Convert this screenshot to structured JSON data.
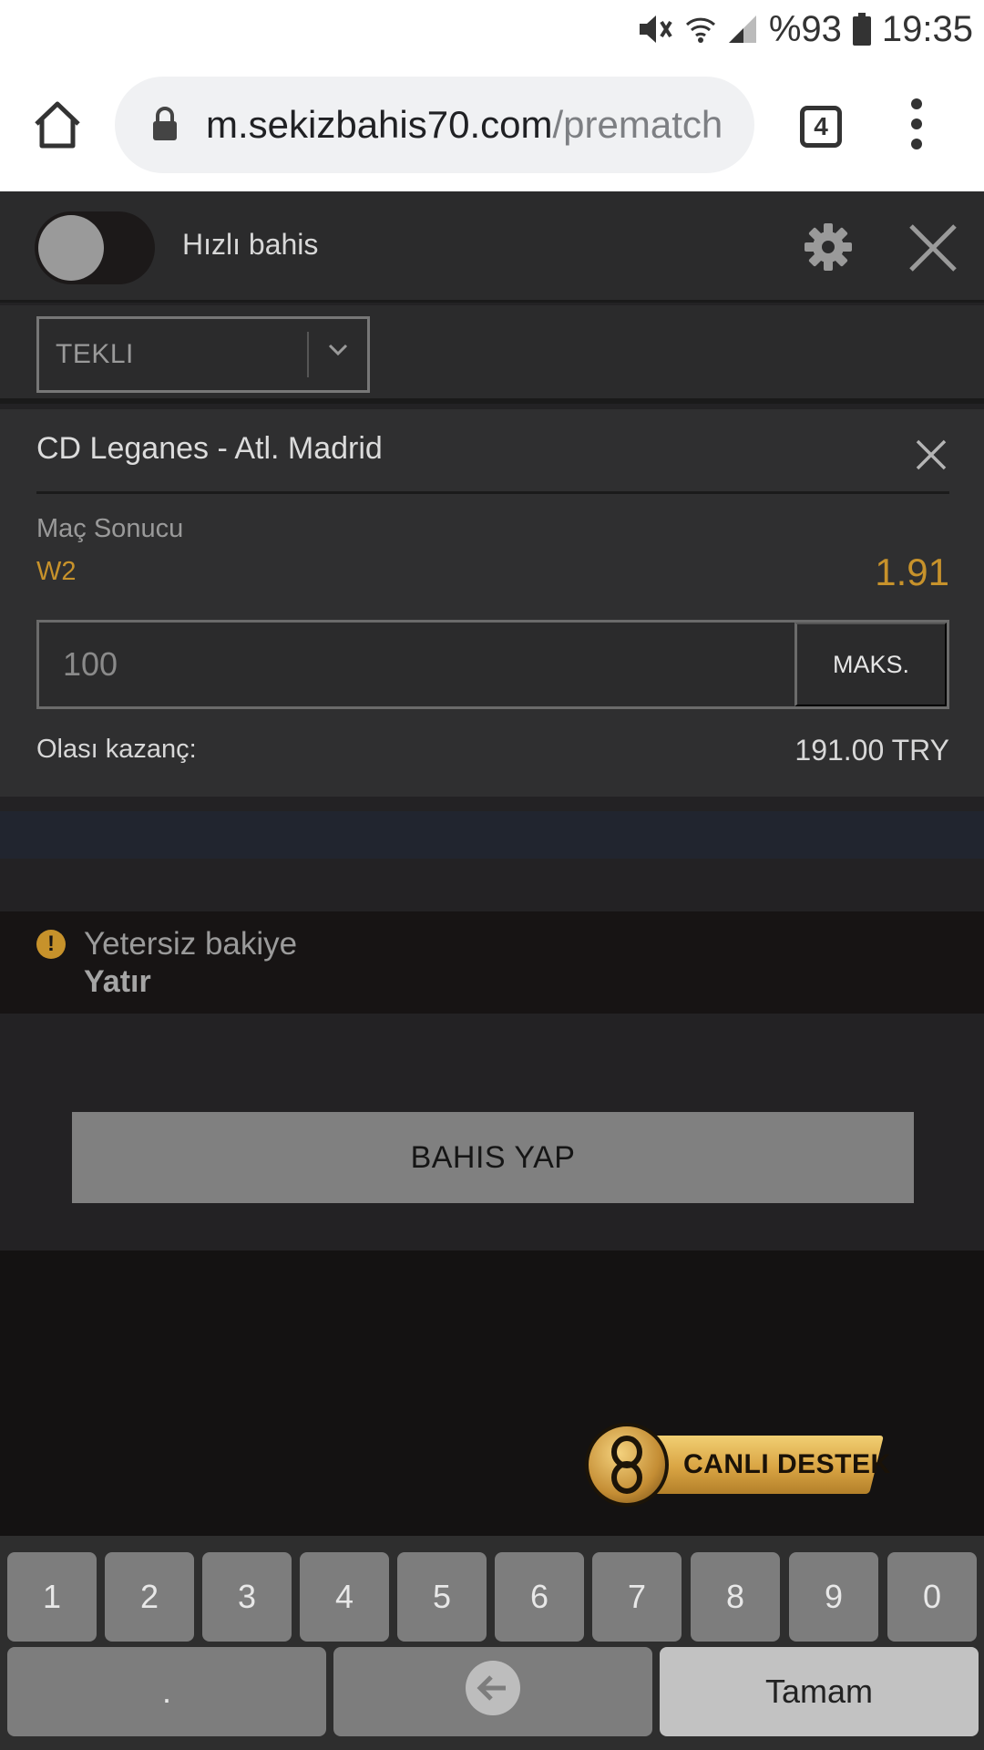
{
  "status_bar": {
    "battery_percent": "%93",
    "time": "19:35"
  },
  "browser": {
    "url_host": "m.sekizbahis70.com",
    "url_path": "/prematch",
    "tab_count": "4"
  },
  "slip": {
    "quick_bet_label": "Hızlı bahis",
    "bet_type": "TEKLI",
    "bet": {
      "match": "CD Leganes - Atl. Madrid",
      "market": "Maç Sonucu",
      "selection": "W2",
      "odds": "1.91",
      "stake_placeholder": "100",
      "max_label": "MAKS.",
      "payout_label": "Olası kazanç:",
      "payout_value": "191.00 TRY"
    },
    "warning": {
      "message": "Yetersiz bakiye",
      "deposit_label": "Yatır"
    },
    "place_bet_label": "BAHIS YAP"
  },
  "live_support": {
    "word1": "CANLI",
    "word2": "DESTEK"
  },
  "keyboard": {
    "keys": [
      "1",
      "2",
      "3",
      "4",
      "5",
      "6",
      "7",
      "8",
      "9",
      "0"
    ],
    "dot_label": ".",
    "done_label": "Tamam"
  }
}
